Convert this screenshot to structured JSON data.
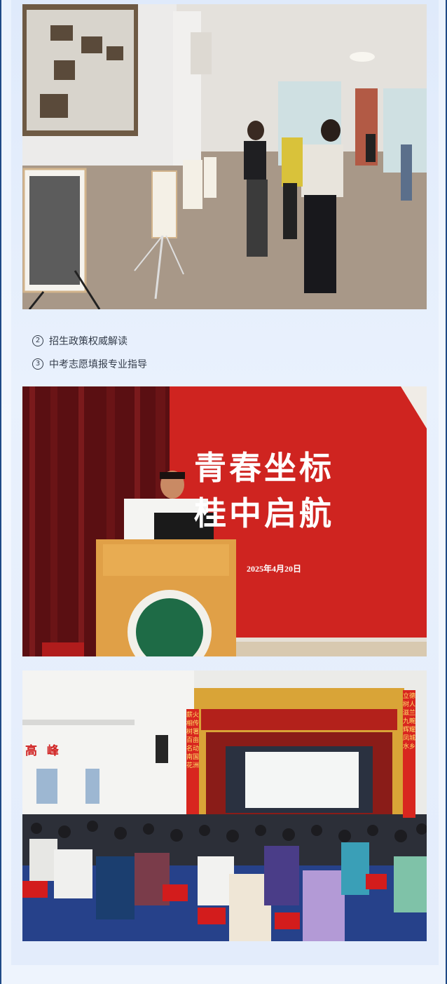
{
  "list": {
    "items": [
      {
        "num": "2",
        "label": "招生政策权威解读"
      },
      {
        "num": "3",
        "label": "中考志愿填报专业指导"
      }
    ]
  },
  "photo2": {
    "slide_title_line1": "青春坐标",
    "slide_title_line2": "桂中启航",
    "slide_date": "2025年4月20日"
  },
  "photo3": {
    "left_banner": "薪火相传树署百亩名动南国花洲",
    "right_banner": "立德树人滋兰九畹辉耀凤城水乡",
    "building_label": "高 峰"
  },
  "colors": {
    "frame_border": "#1f4a86",
    "slide_red": "#c8201e",
    "banner_red": "#d8261f"
  }
}
